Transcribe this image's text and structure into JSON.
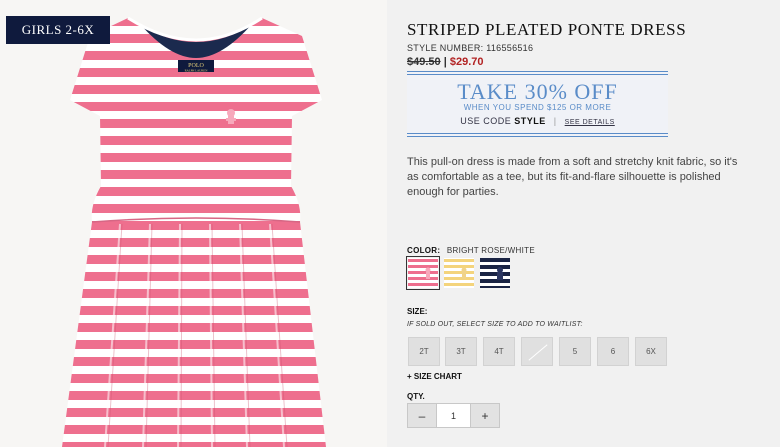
{
  "category_tag": "GIRLS 2-6X",
  "product": {
    "title": "STRIPED PLEATED PONTE DRESS",
    "style_number": "STYLE NUMBER: 116556516",
    "price_old": "$49.50",
    "price_sep": "|",
    "price_new": "$29.70",
    "brand_label_top": "POLO",
    "brand_label_bottom": "RALPH LAUREN"
  },
  "promo": {
    "headline": "TAKE 30% OFF",
    "subline": "WHEN YOU SPEND $125 OR MORE",
    "code_prefix": "USE CODE",
    "code": "STYLE",
    "divider": "|",
    "details_link": "SEE DETAILS"
  },
  "description": "This pull-on dress is made from a soft and stretchy knit fabric, so it's as comfortable as a tee, but its fit-and-flare silhouette is polished enough for parties.",
  "color": {
    "label": "COLOR:",
    "selected_name": "BRIGHT ROSE/WHITE",
    "swatches": [
      {
        "name": "bright-rose-white",
        "stripe": "#ee6f8e",
        "base": "#ffffff",
        "logo": "#f7a8bb"
      },
      {
        "name": "yellow-white",
        "stripe": "#f4d47c",
        "base": "#ffffff",
        "logo": "#f0d38a"
      },
      {
        "name": "navy-white",
        "stripe": "#1a2444",
        "base": "#ffffff",
        "logo": "#2a3560"
      }
    ]
  },
  "size": {
    "label": "SIZE:",
    "note": "IF SOLD OUT, SELECT SIZE TO ADD TO WAITLIST:",
    "options": [
      "2T",
      "3T",
      "4T",
      "",
      "5",
      "6",
      "6X"
    ],
    "chart_link": "+ SIZE CHART"
  },
  "quantity": {
    "label": "QTY.",
    "minus": "–",
    "value": "1",
    "plus": "+"
  },
  "colors": {
    "stripe_pink": "#ee6f8e",
    "navy": "#0f1a3d",
    "sale_red": "#b22222",
    "promo_blue": "#5a8cc8"
  }
}
